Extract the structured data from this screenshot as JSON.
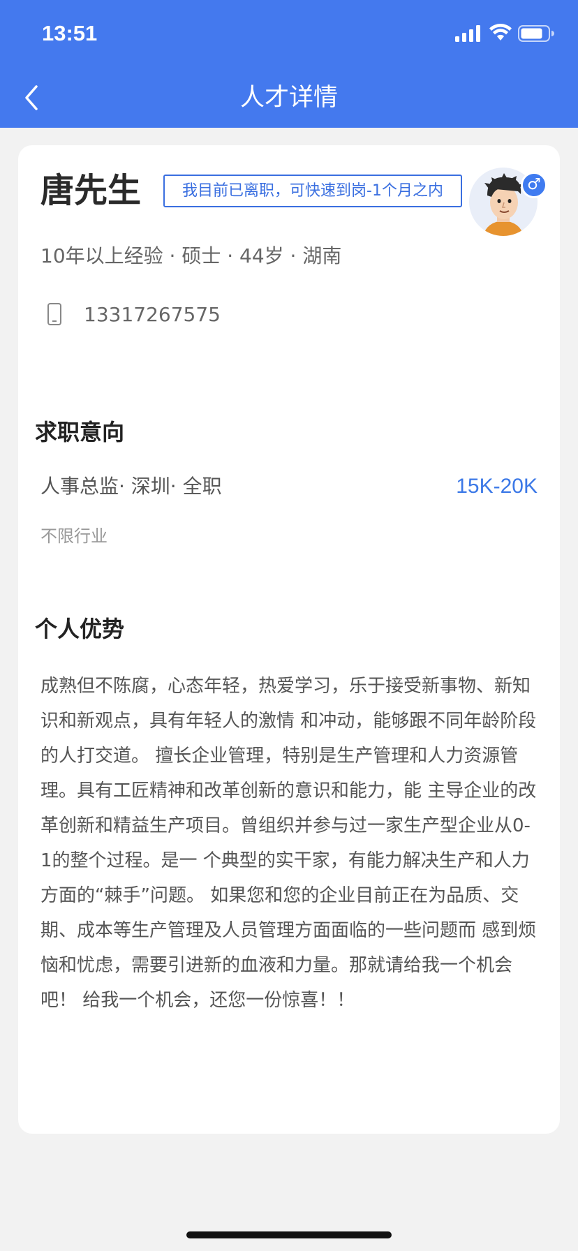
{
  "status_bar": {
    "time": "13:51"
  },
  "nav": {
    "title": "人才详情"
  },
  "profile": {
    "name": "唐先生",
    "status_tag": "我目前已离职，可快速到岗-1个月之内",
    "gender_symbol": "♂",
    "meta": "10年以上经验 · 硕士 · 44岁 · 湖南",
    "phone": "13317267575"
  },
  "job_intent": {
    "section_title": "求职意向",
    "position_line": "人事总监· 深圳· 全职",
    "salary": "15K-20K",
    "industry": "不限行业"
  },
  "advantage": {
    "section_title": "个人优势",
    "text": "成熟但不陈腐，心态年轻，热爱学习，乐于接受新事物、新知识和新观点，具有年轻人的激情 和冲动，能够跟不同年龄阶段的人打交道。 擅长企业管理，特别是生产管理和人力资源管理。具有工匠精神和改革创新的意识和能力，能 主导企业的改革创新和精益生产项目。曾组织并参与过一家生产型企业从0-1的整个过程。是一 个典型的实干家，有能力解决生产和人力方面的“棘手”问题。 如果您和您的企业目前正在为品质、交期、成本等生产管理及人员管理方面面临的一些问题而 感到烦恼和忧虑，需要引进新的血液和力量。那就请给我一个机会吧！ 给我一个机会，还您一份惊喜！！"
  },
  "icons": {
    "back": "chevron-left-icon",
    "phone": "mobile-phone-icon",
    "signal": "cellular-signal-icon",
    "wifi": "wifi-icon",
    "battery": "battery-icon"
  },
  "colors": {
    "header": "#4479ee",
    "accent": "#3a6fe0",
    "salary": "#3b78e7",
    "background": "#f2f2f2"
  }
}
